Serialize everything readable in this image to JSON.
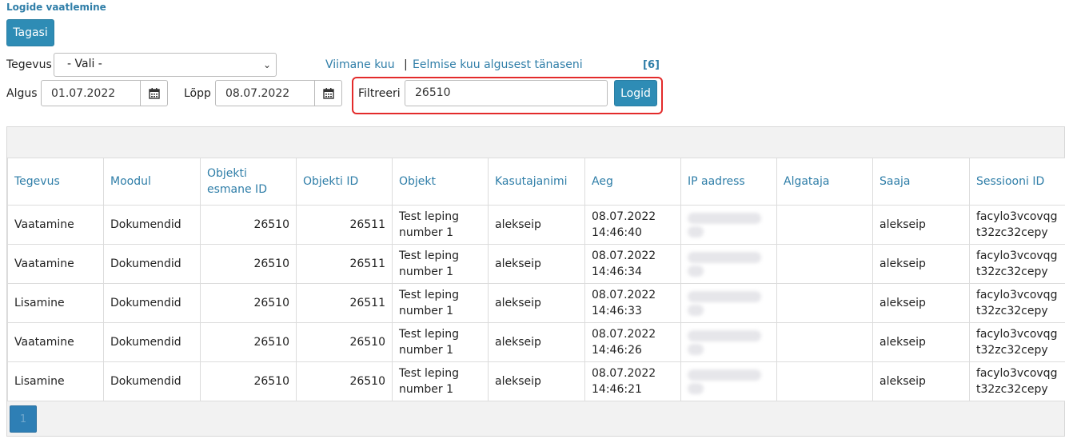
{
  "page": {
    "title": "Logide vaatlemine"
  },
  "toolbar": {
    "back_label": "Tagasi"
  },
  "filters": {
    "action_label": "Tegevus",
    "action_selected": "- Vali -",
    "start_label": "Algus",
    "start_value": "01.07.2022",
    "end_label": "Lõpp",
    "end_value": "08.07.2022",
    "last_month_link": "Viimane kuu",
    "separator": "|",
    "prev_month_link": "Eelmise kuu algusest tänaseni",
    "result_count": "[6]",
    "filter_label": "Filtreeri",
    "filter_value": "26510",
    "submit_label": "Logid"
  },
  "table": {
    "headers": [
      "Tegevus",
      "Moodul",
      "Objekti esmane ID",
      "Objekti ID",
      "Objekt",
      "Kasutajanimi",
      "Aeg",
      "IP aadress",
      "Algataja",
      "Saaja",
      "Sessiooni ID"
    ],
    "rows": [
      {
        "action": "Vaatamine",
        "module": "Dokumendid",
        "orig_id": "26510",
        "obj_id": "26511",
        "obj_line1": "Test leping",
        "obj_line2": "number 1",
        "user": "alekseip",
        "date": "08.07.2022",
        "time": "14:46:40",
        "initiator": "",
        "recipient": "alekseip",
        "sess_line1": "facylo3vcovqg",
        "sess_line2": "t32zc32cepy"
      },
      {
        "action": "Vaatamine",
        "module": "Dokumendid",
        "orig_id": "26510",
        "obj_id": "26511",
        "obj_line1": "Test leping",
        "obj_line2": "number 1",
        "user": "alekseip",
        "date": "08.07.2022",
        "time": "14:46:34",
        "initiator": "",
        "recipient": "alekseip",
        "sess_line1": "facylo3vcovqg",
        "sess_line2": "t32zc32cepy"
      },
      {
        "action": "Lisamine",
        "module": "Dokumendid",
        "orig_id": "26510",
        "obj_id": "26511",
        "obj_line1": "Test leping",
        "obj_line2": "number 1",
        "user": "alekseip",
        "date": "08.07.2022",
        "time": "14:46:33",
        "initiator": "",
        "recipient": "alekseip",
        "sess_line1": "facylo3vcovqg",
        "sess_line2": "t32zc32cepy"
      },
      {
        "action": "Vaatamine",
        "module": "Dokumendid",
        "orig_id": "26510",
        "obj_id": "26510",
        "obj_line1": "Test leping",
        "obj_line2": "number 1",
        "user": "alekseip",
        "date": "08.07.2022",
        "time": "14:46:26",
        "initiator": "",
        "recipient": "alekseip",
        "sess_line1": "facylo3vcovqg",
        "sess_line2": "t32zc32cepy"
      },
      {
        "action": "Lisamine",
        "module": "Dokumendid",
        "orig_id": "26510",
        "obj_id": "26510",
        "obj_line1": "Test leping",
        "obj_line2": "number 1",
        "user": "alekseip",
        "date": "08.07.2022",
        "time": "14:46:21",
        "initiator": "",
        "recipient": "alekseip",
        "sess_line1": "facylo3vcovqg",
        "sess_line2": "t32zc32cepy"
      }
    ]
  },
  "pager": {
    "current_page": "1"
  },
  "colors": {
    "accent": "#2e8cb5",
    "link": "#2f7ea8",
    "highlight": "#e32b2b"
  }
}
